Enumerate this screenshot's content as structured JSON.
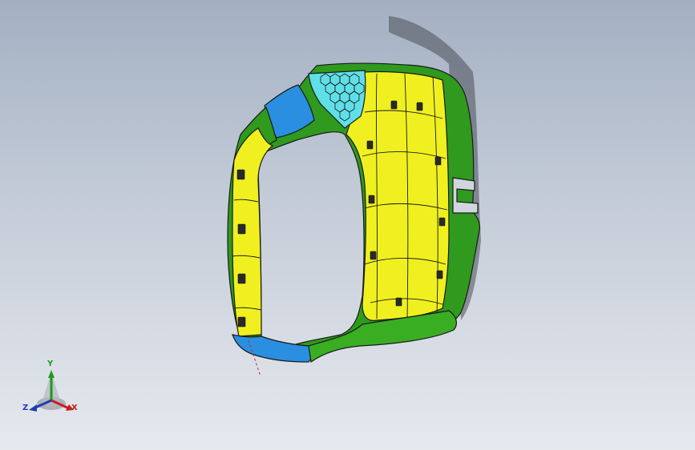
{
  "viewport": {
    "background_top": "#a3b0c2",
    "background_bottom": "#e6e9ee",
    "model_colors": {
      "green": "#2f9a1e",
      "yellow": "#f0f020",
      "blue": "#2a8fe0",
      "cyan": "#5fe0e8",
      "edge": "#1a1a1a"
    }
  },
  "triad": {
    "x_label": "X",
    "y_label": "Y",
    "z_label": "Z",
    "x_color": "#c81e1e",
    "y_color": "#1d9a1d",
    "z_color": "#1e3cb4"
  }
}
